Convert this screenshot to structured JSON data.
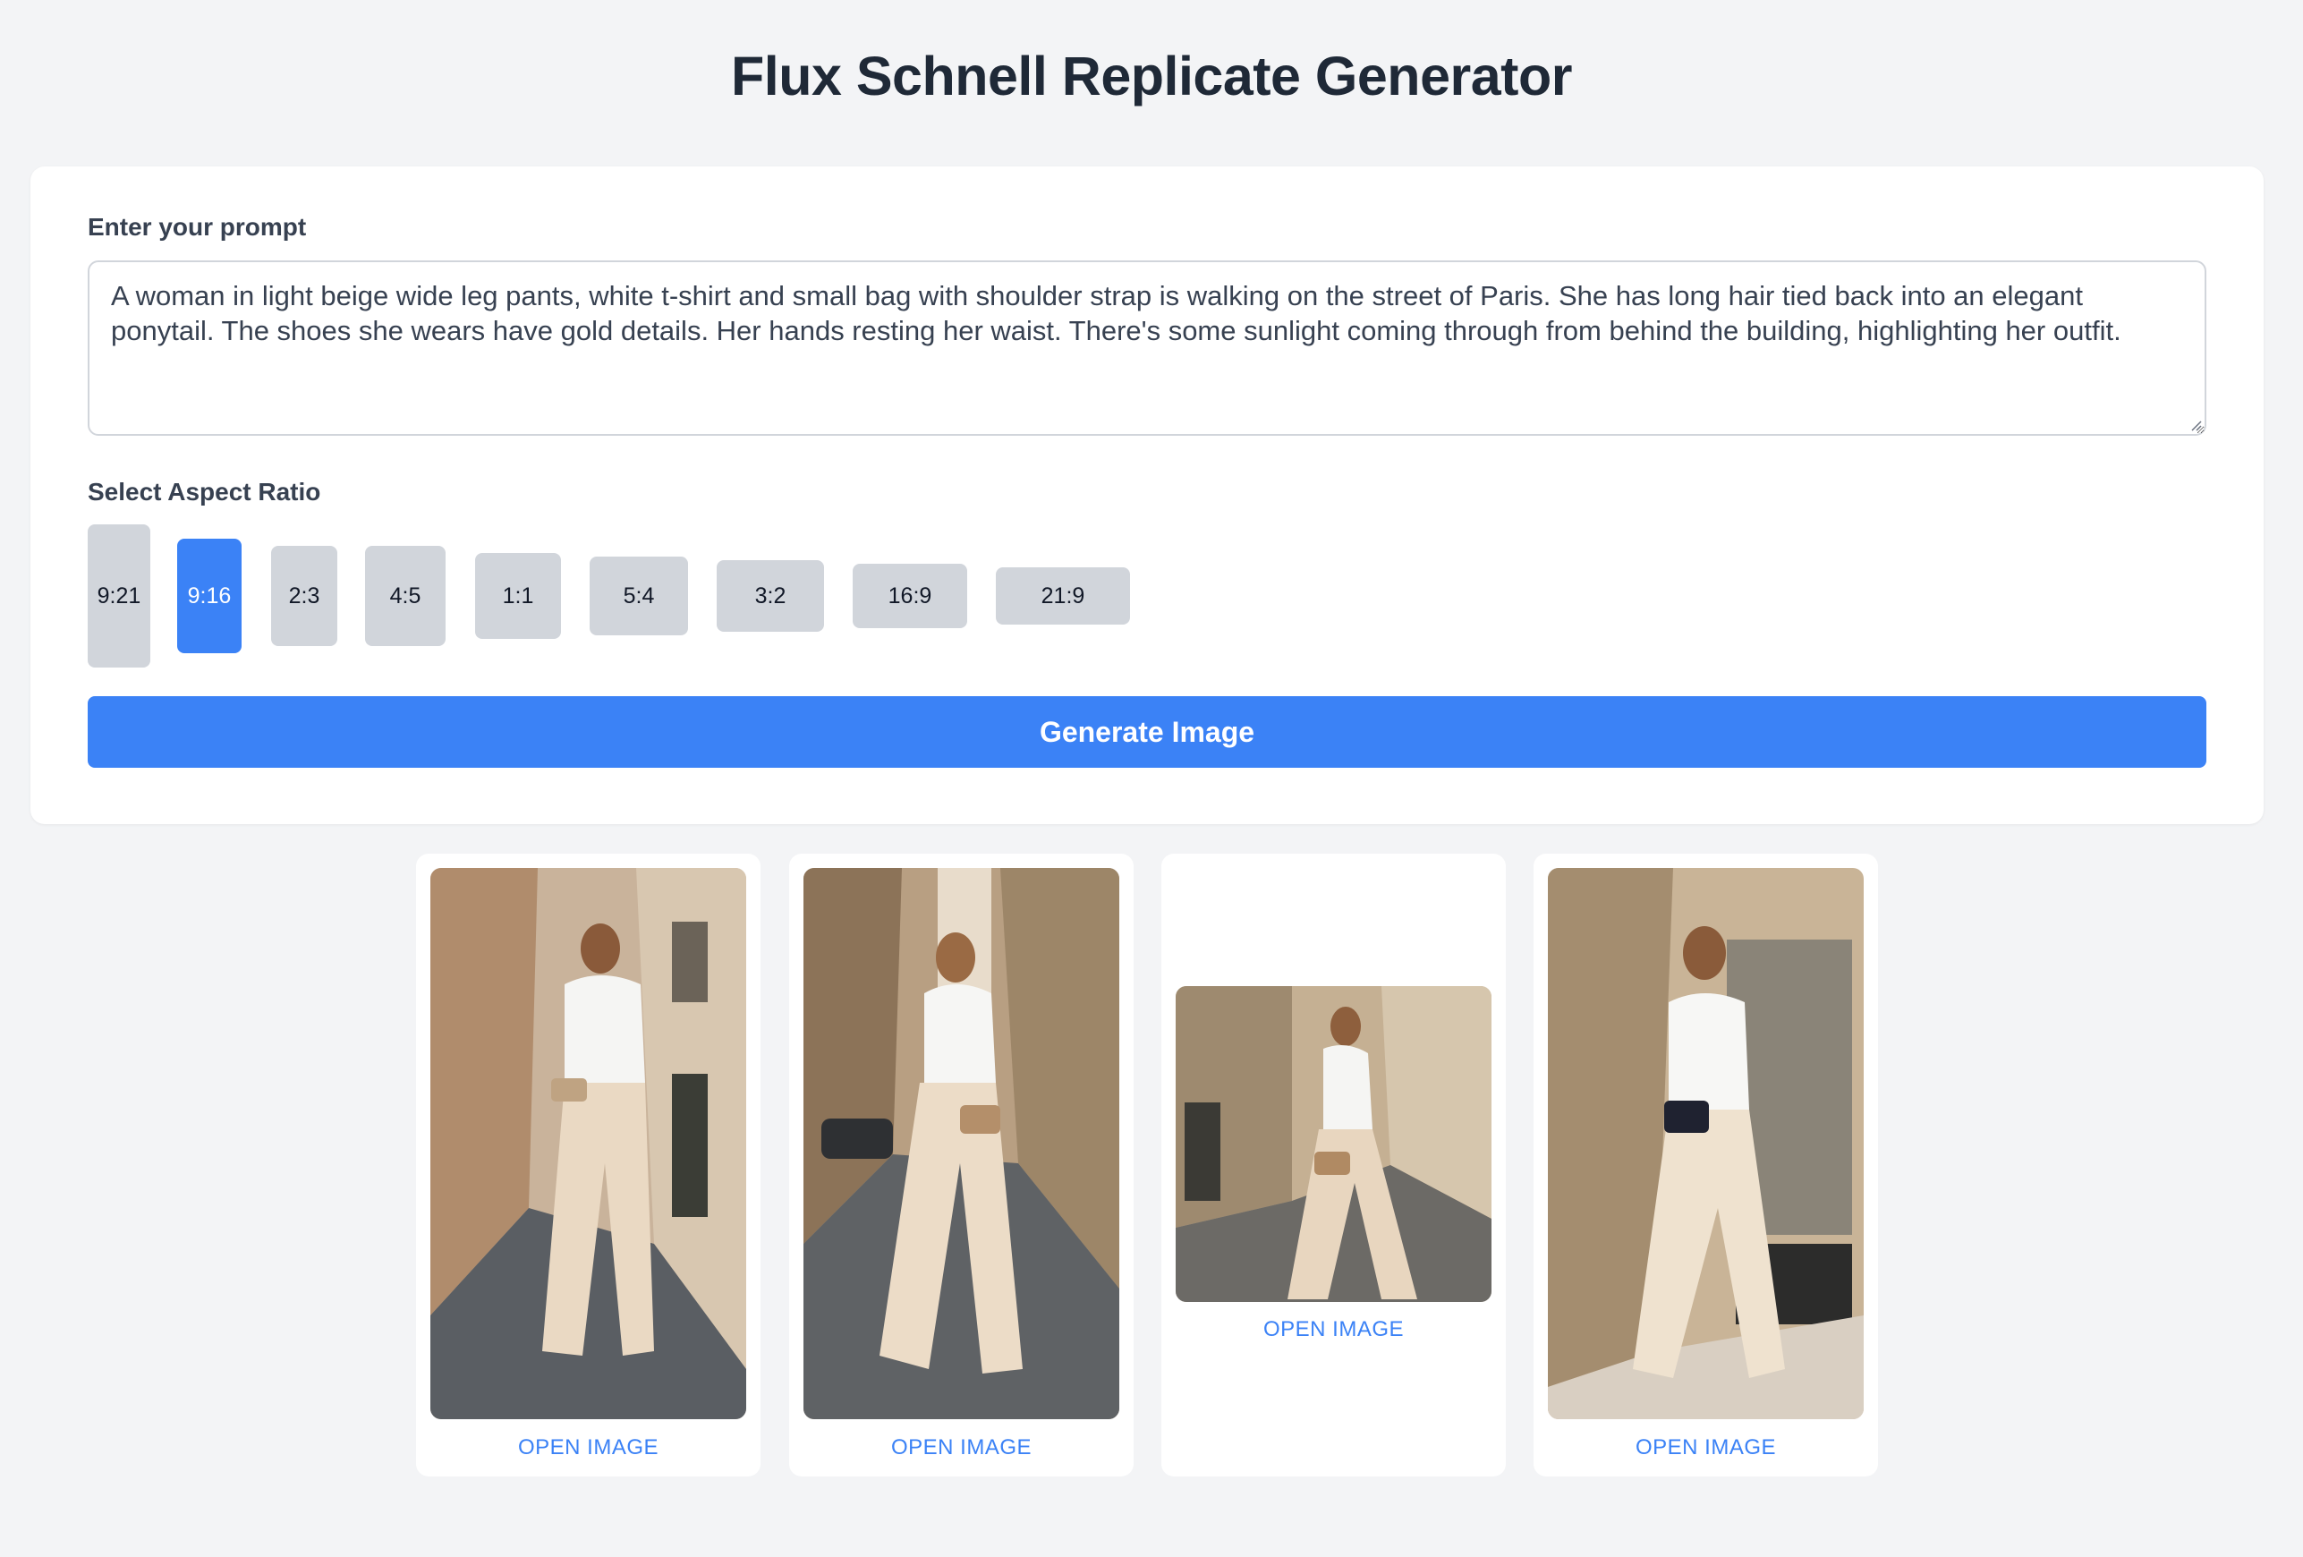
{
  "header": {
    "title": "Flux Schnell Replicate Generator"
  },
  "form": {
    "prompt_label": "Enter your prompt",
    "prompt_value": "A woman in light beige wide leg pants, white t-shirt and small bag with shoulder strap is walking on the street of Paris. She has long hair tied back into an elegant ponytail. The shoes she wears have gold details. Her hands resting her waist. There's some sunlight coming through from behind the building, highlighting her outfit.",
    "aspect_label": "Select Aspect Ratio",
    "aspect_ratios": [
      {
        "label": "9:21",
        "selected": false
      },
      {
        "label": "9:16",
        "selected": true
      },
      {
        "label": "2:3",
        "selected": false
      },
      {
        "label": "4:5",
        "selected": false
      },
      {
        "label": "1:1",
        "selected": false
      },
      {
        "label": "5:4",
        "selected": false
      },
      {
        "label": "3:2",
        "selected": false
      },
      {
        "label": "16:9",
        "selected": false
      },
      {
        "label": "21:9",
        "selected": false
      }
    ],
    "generate_label": "Generate Image"
  },
  "results": [
    {
      "link_label": "OPEN IMAGE"
    },
    {
      "link_label": "OPEN IMAGE"
    },
    {
      "link_label": "OPEN IMAGE"
    },
    {
      "link_label": "OPEN IMAGE"
    }
  ],
  "colors": {
    "accent": "#3b82f6",
    "background": "#f3f4f6",
    "button_gray": "#d1d5db"
  }
}
